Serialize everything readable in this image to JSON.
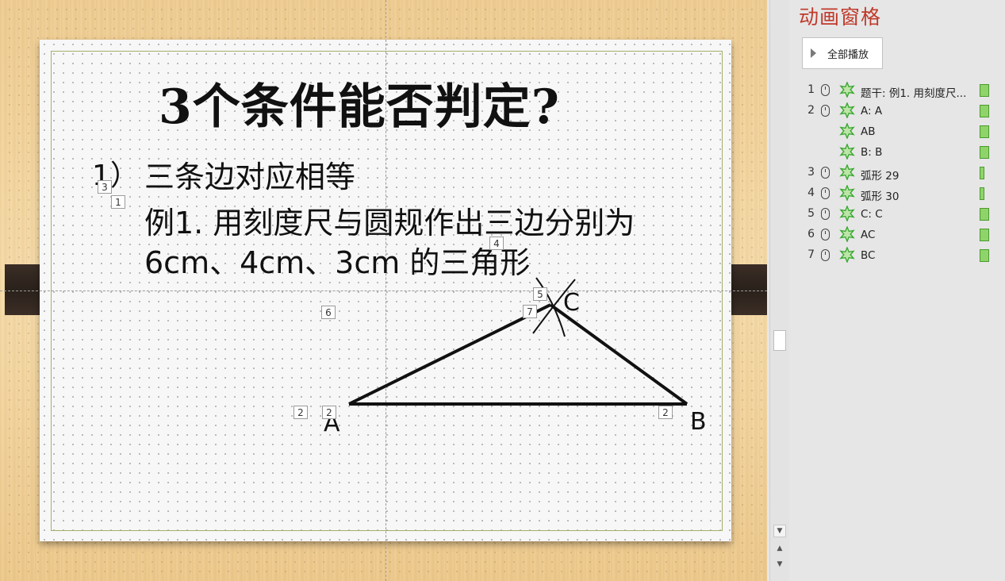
{
  "slide": {
    "title": "3个条件能否判定?",
    "item_num": "1）",
    "item_text": "三条边对应相等",
    "example_line1": "例1. 用刻度尺与圆规作出三边分别为",
    "example_line2": "6cm、4cm、3cm 的三角形",
    "points": {
      "A": "A",
      "B": "B",
      "C": "C"
    },
    "tags": [
      "3",
      "1",
      "4",
      "5",
      "7",
      "6",
      "2",
      "2",
      "2"
    ]
  },
  "animation_pane": {
    "title": "动画窗格",
    "play_all_label": "全部播放",
    "items": [
      {
        "num": "1",
        "label": "题干: 例1. 用刻度尺...",
        "trigger": "on-click",
        "bar_width": 0.2
      },
      {
        "num": "2",
        "label": "A: A",
        "trigger": "on-click",
        "bar_width": 0.2
      },
      {
        "num": "",
        "label": "AB",
        "trigger": "with-previous",
        "bar_width": 0.2
      },
      {
        "num": "",
        "label": "B: B",
        "trigger": "with-previous",
        "bar_width": 0.2
      },
      {
        "num": "3",
        "label": "弧形 29",
        "trigger": "on-click",
        "bar_width": 0.1
      },
      {
        "num": "4",
        "label": "弧形 30",
        "trigger": "on-click",
        "bar_width": 0.1
      },
      {
        "num": "5",
        "label": "C: C",
        "trigger": "on-click",
        "bar_width": 0.2
      },
      {
        "num": "6",
        "label": "AC",
        "trigger": "on-click",
        "bar_width": 0.2
      },
      {
        "num": "7",
        "label": "BC",
        "trigger": "on-click",
        "bar_width": 0.2
      }
    ]
  },
  "colors": {
    "pane_title": "#c0392b",
    "timing_bar": "#8fd46a",
    "effect_star": "#3aa832"
  },
  "icons": {
    "scroll_down": "chevron-down-icon",
    "prev_slide": "double-chevron-up-icon",
    "next_slide": "double-chevron-down-icon",
    "trigger": "mouse-icon",
    "effect": "star-icon",
    "play": "play-icon"
  }
}
